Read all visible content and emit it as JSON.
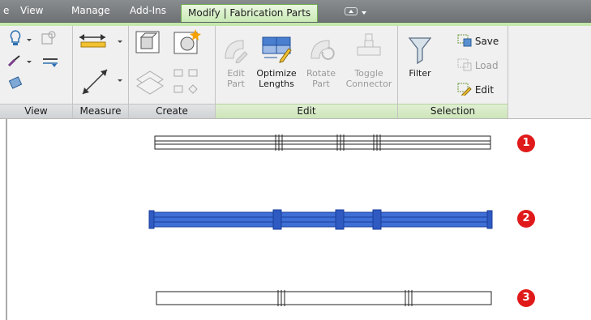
{
  "tabs": [
    {
      "label": "e",
      "active": false
    },
    {
      "label": "View",
      "active": false
    },
    {
      "label": "Manage",
      "active": false
    },
    {
      "label": "Add-Ins",
      "active": false
    },
    {
      "label": "Modify | Fabrication Parts",
      "active": true
    }
  ],
  "panels": {
    "view": {
      "label": "View"
    },
    "measure": {
      "label": "Measure"
    },
    "create": {
      "label": "Create"
    },
    "edit": {
      "label": "Edit",
      "buttons": [
        {
          "line1": "Edit",
          "line2": "Part",
          "enabled": false
        },
        {
          "line1": "Optimize",
          "line2": "Lengths",
          "enabled": true
        },
        {
          "line1": "Rotate",
          "line2": "Part",
          "enabled": false
        },
        {
          "line1": "Toggle",
          "line2": "Connector",
          "enabled": false
        }
      ]
    },
    "selection": {
      "label": "Selection",
      "filter_label": "Filter",
      "save_label": "Save",
      "load_label": "Load",
      "edit_label": "Edit"
    }
  },
  "callouts": [
    "1",
    "2",
    "3"
  ],
  "colors": {
    "active_tab": "#c9eab5",
    "selection_blue": "#2f5fd0",
    "callout_red": "#e01a1a"
  }
}
